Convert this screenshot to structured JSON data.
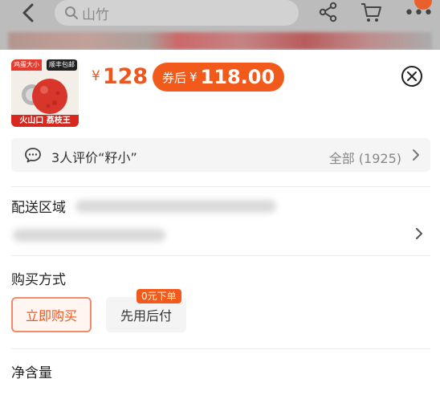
{
  "header": {
    "search_text": "山竹",
    "more_glyph": "•••"
  },
  "product": {
    "thumb_tag_left": "鸡蛋大小",
    "thumb_tag_right": "顺丰包邮",
    "thumb_caption": "火山口 荔枝王",
    "price_currency": "¥",
    "price": "128",
    "coupon_label": "券后",
    "coupon_currency": "¥",
    "coupon_price": "118.00"
  },
  "review": {
    "text": "3人评价“籽小”",
    "all_label": "全部 (1925)"
  },
  "delivery": {
    "label": "配送区域"
  },
  "purchase": {
    "label": "购买方式",
    "options": [
      "立即购买",
      "先用后付"
    ],
    "later_tag": "0元下单"
  },
  "net": {
    "label": "净含量"
  },
  "colors": {
    "accent": "#f2541b",
    "coupon_bg": "#f15a1b"
  }
}
